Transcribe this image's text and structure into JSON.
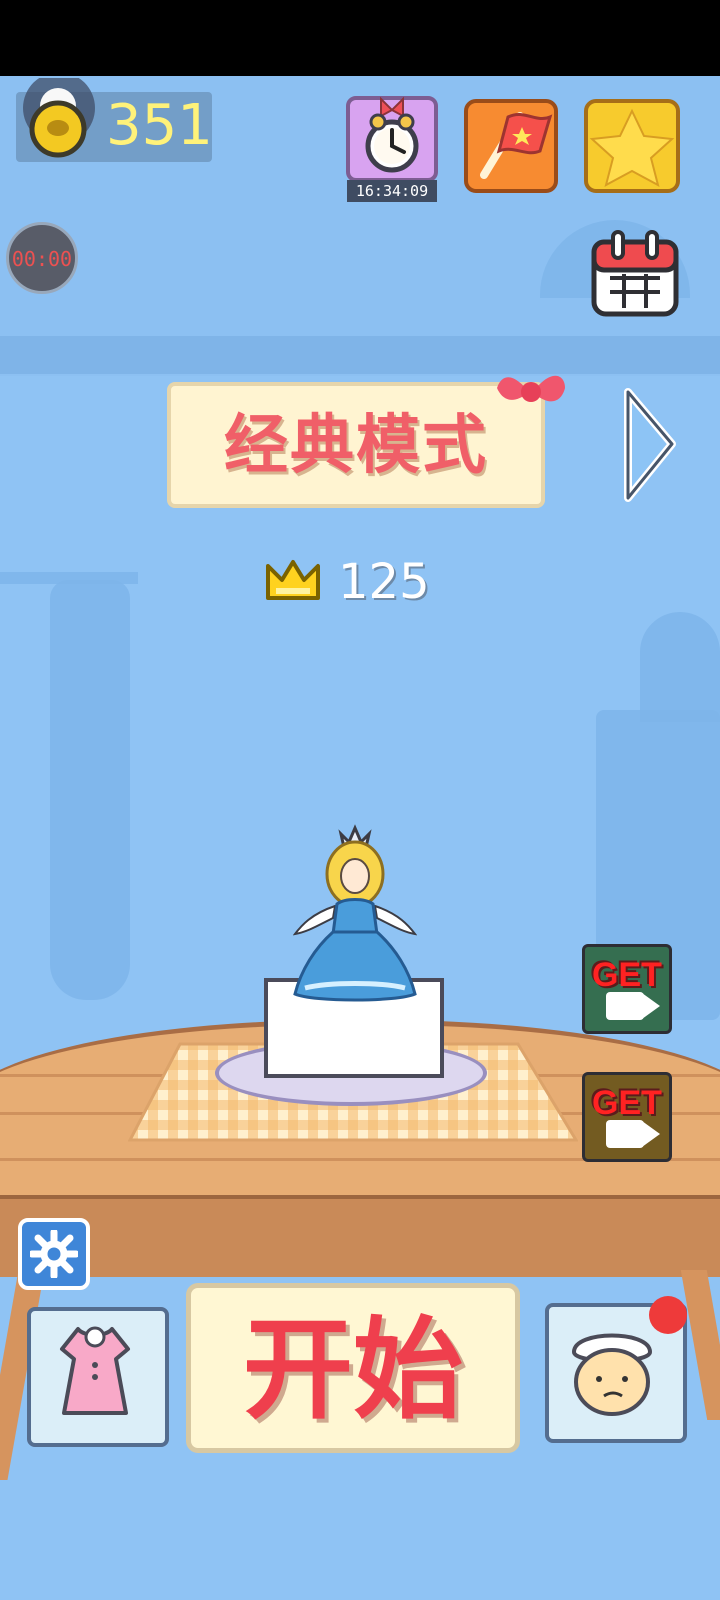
{
  "status": {
    "coins": "351",
    "timer": "00:00",
    "event_clock": "16:34:09"
  },
  "mode": {
    "title": "经典模式",
    "best_score": "125"
  },
  "buttons": {
    "start_label": "开始",
    "reward_video_1": "GET",
    "reward_video_2": "GET"
  },
  "icons": {
    "coin": "coin-icon",
    "alarm_clock": "alarm-clock-icon",
    "flag": "flag-icon",
    "sp": "sp-star-icon",
    "calendar": "calendar-icon",
    "crown": "crown-icon",
    "settings": "gear-icon",
    "dress": "dress-icon",
    "chef": "chef-icon",
    "next": "chevron-right-icon",
    "video": "video-camera-icon"
  },
  "colors": {
    "background": "#8fc3f4",
    "title_red": "#f05f68",
    "banner_cream": "#fff4d1",
    "coin_yellow": "#fff27a",
    "alert_red": "#ee3a3a"
  }
}
